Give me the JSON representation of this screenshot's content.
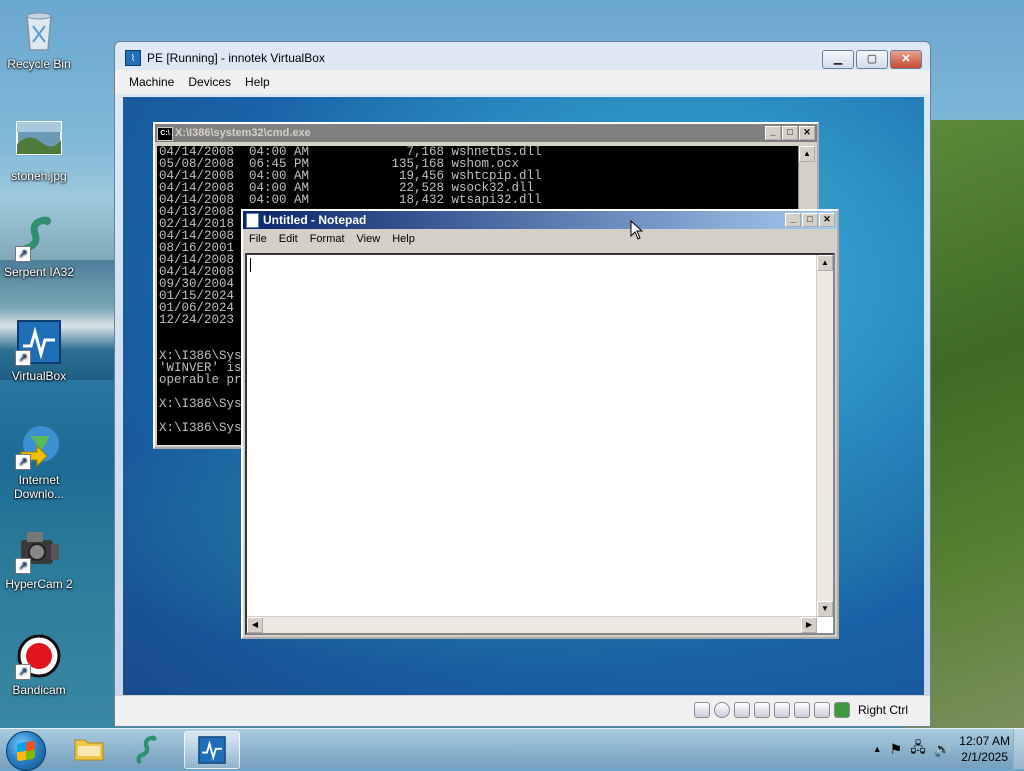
{
  "desktop": {
    "icons": [
      {
        "label": "Recycle Bin"
      },
      {
        "label": "stoneh.jpg"
      },
      {
        "label": "Serpent IA32"
      },
      {
        "label": "VirtualBox"
      },
      {
        "label": "Internet Downlo..."
      },
      {
        "label": "HyperCam 2"
      },
      {
        "label": "Bandicam"
      }
    ]
  },
  "vbox": {
    "title": "PE [Running] - innotek VirtualBox",
    "menu": [
      "Machine",
      "Devices",
      "Help"
    ],
    "status": {
      "host_key": "Right Ctrl"
    }
  },
  "cmd": {
    "title": "X:\\I386\\system32\\cmd.exe",
    "lines": [
      "04/14/2008  04:00 AM             7,168 wshnetbs.dll",
      "05/08/2008  06:45 PM           135,168 wshom.ocx",
      "04/14/2008  04:00 AM            19,456 wshtcpip.dll",
      "04/14/2008  04:00 AM            22,528 wsock32.dll",
      "04/14/2008  04:00 AM            18,432 wtsapi32.dll",
      "04/13/2008",
      "02/14/2018",
      "04/14/2008",
      "08/16/2001",
      "04/14/2008",
      "04/14/2008",
      "09/30/2004",
      "01/15/2024",
      "01/06/2024",
      "12/24/2023",
      "",
      "",
      "X:\\I386\\Sys",
      "'WINVER' is",
      "operable pr",
      "",
      "X:\\I386\\Sys",
      "",
      "X:\\I386\\Sys"
    ]
  },
  "notepad": {
    "title": "Untitled - Notepad",
    "menu": [
      "File",
      "Edit",
      "Format",
      "View",
      "Help"
    ],
    "content": ""
  },
  "taskbar": {
    "clock_time": "12:07 AM",
    "clock_date": "2/1/2025"
  }
}
